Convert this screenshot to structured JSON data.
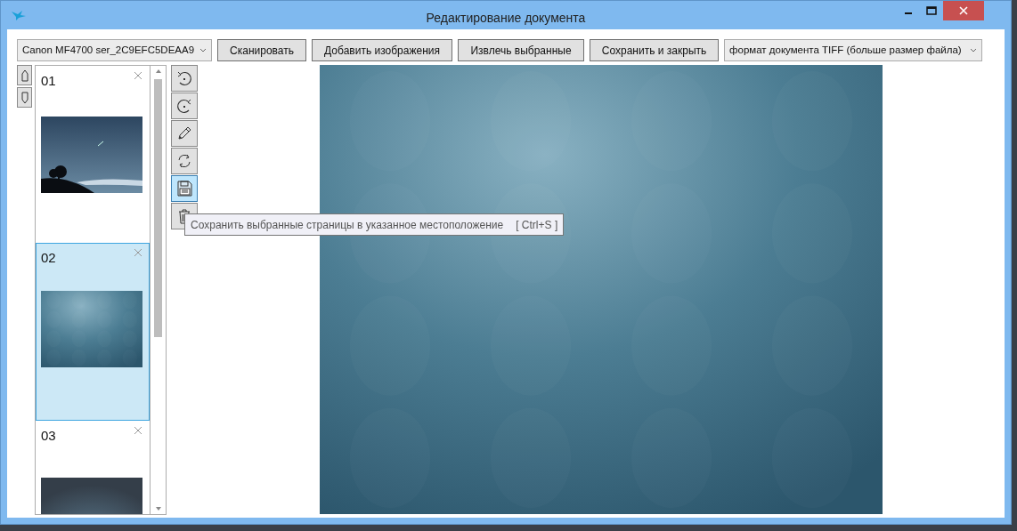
{
  "window": {
    "title": "Редактирование документа"
  },
  "toolbar": {
    "scanner": {
      "value": "Canon MF4700 ser_2C9EFC5DEAA9"
    },
    "buttons": [
      "Сканировать",
      "Добавить изображения",
      "Извлечь выбранные",
      "Сохранить и закрыть"
    ],
    "format": {
      "value": "формат документа TIFF  (больше размер файла)"
    }
  },
  "move_buttons": [
    {
      "kind": "up"
    },
    {
      "kind": "down"
    }
  ],
  "pages": [
    {
      "label": "01",
      "selected": false
    },
    {
      "label": "02",
      "selected": true
    },
    {
      "label": "03",
      "selected": false
    }
  ],
  "tools": [
    {
      "kind": "rotate-left",
      "highlighted": false
    },
    {
      "kind": "rotate-right",
      "highlighted": false
    },
    {
      "kind": "edit",
      "highlighted": false
    },
    {
      "kind": "refresh",
      "highlighted": false
    },
    {
      "kind": "save",
      "highlighted": true
    },
    {
      "kind": "delete",
      "highlighted": false
    }
  ],
  "tooltip": {
    "text": "Сохранить выбранные страницы в указанное местоположение",
    "shortcut": "[ Ctrl+S ]"
  }
}
